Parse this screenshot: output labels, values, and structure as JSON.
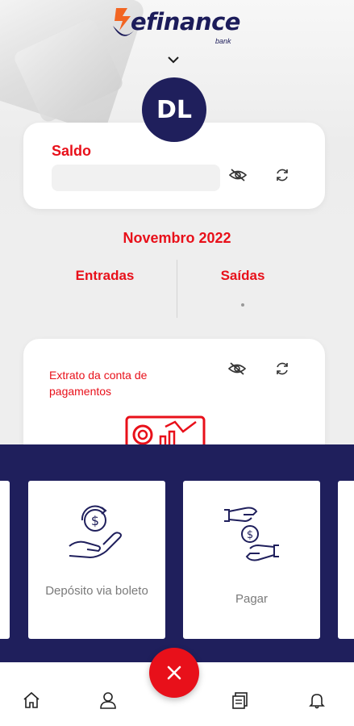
{
  "brand": {
    "name": "efinance",
    "sub": "bank",
    "colors": {
      "primary": "#1f1f5c",
      "accent": "#e8101a",
      "orange": "#f26522"
    }
  },
  "header": {
    "expand_icon": "chevron-down-icon"
  },
  "user": {
    "initials": "DL"
  },
  "saldo": {
    "title": "Saldo",
    "hide_icon": "eye-off-icon",
    "refresh_icon": "refresh-icon"
  },
  "period": {
    "month": "Novembro 2022",
    "entradas_label": "Entradas",
    "saidas_label": "Saídas"
  },
  "extrato": {
    "title": "Extrato da conta de pagamentos",
    "hide_icon": "eye-off-icon",
    "refresh_icon": "refresh-icon"
  },
  "actions": [
    {
      "label": "Depósito via boleto",
      "icon": "hand-coin-icon"
    },
    {
      "label": "Pagar",
      "icon": "hands-exchange-money-icon"
    }
  ],
  "fab": {
    "icon": "close-icon"
  },
  "bottom_nav": [
    {
      "icon": "home-icon"
    },
    {
      "icon": "user-icon"
    },
    {
      "icon": "document-icon"
    },
    {
      "icon": "bell-icon"
    }
  ]
}
